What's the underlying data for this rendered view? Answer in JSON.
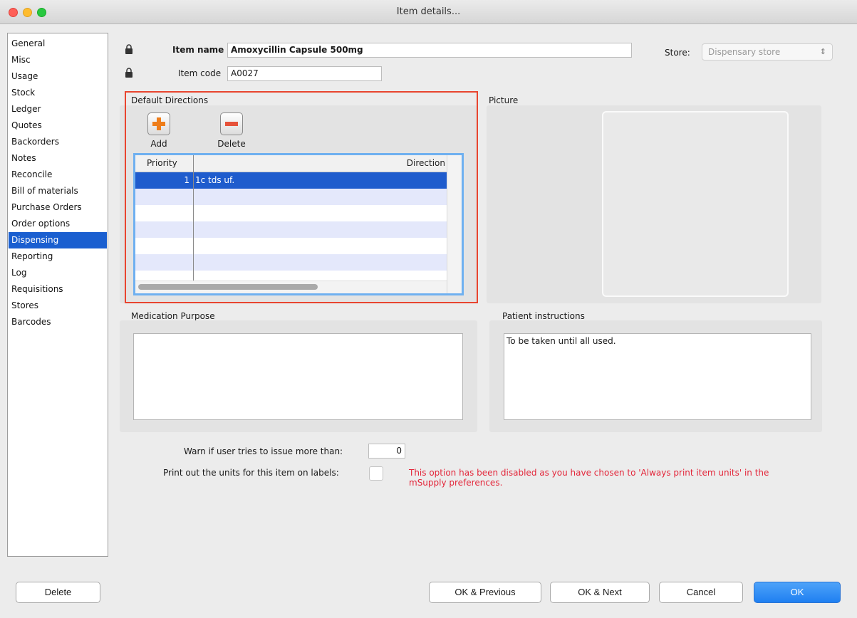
{
  "window": {
    "title": "Item details..."
  },
  "sidebar": {
    "items": [
      {
        "label": "General"
      },
      {
        "label": "Misc"
      },
      {
        "label": "Usage"
      },
      {
        "label": "Stock"
      },
      {
        "label": "Ledger"
      },
      {
        "label": "Quotes"
      },
      {
        "label": "Backorders"
      },
      {
        "label": "Notes"
      },
      {
        "label": "Reconcile"
      },
      {
        "label": "Bill of materials"
      },
      {
        "label": "Purchase Orders"
      },
      {
        "label": "Order options"
      },
      {
        "label": "Dispensing"
      },
      {
        "label": "Reporting"
      },
      {
        "label": "Log"
      },
      {
        "label": "Requisitions"
      },
      {
        "label": "Stores"
      },
      {
        "label": "Barcodes"
      }
    ],
    "active_label": "Dispensing"
  },
  "header": {
    "item_name_label": "Item name",
    "item_name_value": "Amoxycillin Capsule 500mg",
    "item_code_label": "Item code",
    "item_code_value": "A0027",
    "store_label": "Store:",
    "store_value": "Dispensary store"
  },
  "directions": {
    "title": "Default Directions",
    "add_label": "Add",
    "delete_label": "Delete",
    "columns": {
      "priority": "Priority",
      "direction": "Direction"
    },
    "rows": [
      {
        "priority": "1",
        "direction": "1c tds uf."
      }
    ]
  },
  "picture": {
    "title": "Picture"
  },
  "medication_purpose": {
    "title": "Medication Purpose",
    "value": ""
  },
  "patient_instructions": {
    "title": "Patient instructions",
    "value": "To be taken until all used."
  },
  "warn": {
    "label": "Warn if user tries to issue more than:",
    "value": "0"
  },
  "print_units": {
    "label": "Print out the units for this item on labels:",
    "checked": false,
    "notice_line1": "This option has been disabled as you have chosen to 'Always print item units' in the",
    "notice_line2": "mSupply preferences."
  },
  "buttons": {
    "delete": "Delete",
    "ok_previous": "OK & Previous",
    "ok_next": "OK & Next",
    "cancel": "Cancel",
    "ok": "OK"
  },
  "colors": {
    "accent": "#1a5fd0",
    "warning": "#e3263a",
    "highlight_box": "#e8452f"
  }
}
